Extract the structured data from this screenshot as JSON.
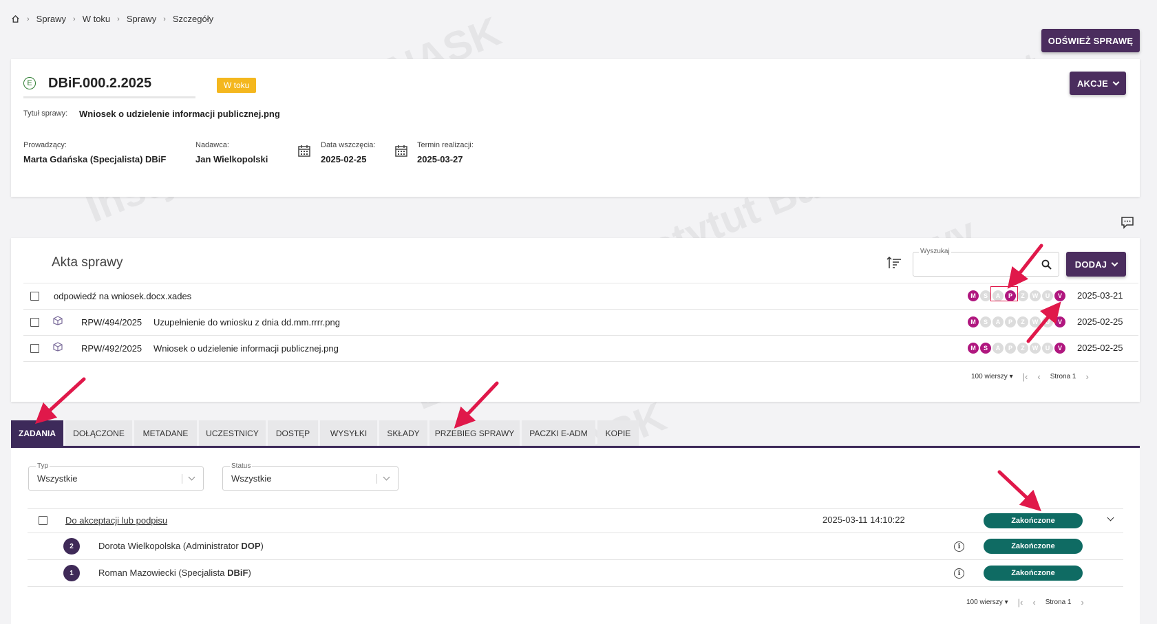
{
  "breadcrumb": {
    "home_icon": "home-icon",
    "items": [
      "Sprawy",
      "W toku",
      "Sprawy",
      "Szczegóły"
    ]
  },
  "header_actions": {
    "refresh_label": "ODŚWIEŻ SPRAWĘ",
    "actions_label": "AKCJE"
  },
  "case": {
    "number": "DBiF.000.2.2025",
    "status": "W toku",
    "title_label": "Tytuł sprawy:",
    "title_value": "Wniosek o udzielenie informacji publicznej.png",
    "fields": {
      "owner_label": "Prowadzący:",
      "owner_value": "Marta Gdańska (Specjalista) DBiF",
      "sender_label": "Nadawca:",
      "sender_value": "Jan Wielkopolski",
      "start_label": "Data wszczęcia:",
      "start_value": "2025-02-25",
      "due_label": "Termin realizacji:",
      "due_value": "2025-03-27"
    }
  },
  "akta": {
    "title": "Akta sprawy",
    "search_label": "Wyszukaj",
    "add_label": "DODAJ",
    "rows": [
      {
        "ref": "",
        "name": "odpowiedź na wniosek.docx.xades",
        "date": "2025-03-21",
        "dots": [
          1,
          0,
          0,
          1,
          0,
          0,
          0,
          1
        ]
      },
      {
        "ref": "RPW/494/2025",
        "name": "Uzupełnienie do wniosku z dnia dd.mm.rrrr.png",
        "date": "2025-02-25",
        "dots": [
          1,
          0,
          0,
          0,
          0,
          0,
          0,
          1
        ]
      },
      {
        "ref": "RPW/492/2025",
        "name": "Wniosek o udzielenie informacji publicznej.png",
        "date": "2025-02-25",
        "dots": [
          1,
          1,
          0,
          0,
          0,
          0,
          0,
          1
        ]
      }
    ],
    "dot_letters": [
      "M",
      "S",
      "A",
      "P",
      "Z",
      "W",
      "U",
      "V"
    ],
    "pager": {
      "rows": "100 wierszy",
      "page": "Strona 1"
    }
  },
  "tabs": [
    "ZADANIA",
    "DOŁĄCZONE",
    "METADANE",
    "UCZESTNICY",
    "DOSTĘP",
    "WYSYŁKI",
    "SKŁADY",
    "PRZEBIEG SPRAWY",
    "PACZKI E-ADM",
    "KOPIE"
  ],
  "filters": {
    "type_label": "Typ",
    "type_value": "Wszystkie",
    "status_label": "Status",
    "status_value": "Wszystkie"
  },
  "tasks": {
    "main": {
      "name": "Do akceptacji lub podpisu",
      "datetime": "2025-03-11 14:10:22",
      "status": "Zakończone"
    },
    "subs": [
      {
        "num": "2",
        "person": "Dorota Wielkopolska (Administrator ",
        "dept": "DOP",
        "close": ")",
        "status": "Zakończone"
      },
      {
        "num": "1",
        "person": "Roman Mazowiecki (Specjalista ",
        "dept": "DBiF",
        "close": ")",
        "status": "Zakończone"
      }
    ],
    "pager": {
      "rows": "100 wierszy",
      "page": "Strona 1"
    }
  },
  "colors": {
    "primary": "#4b2d5e",
    "status_yellow": "#f4b71e",
    "done_green": "#0f6b63",
    "signature_on": "#b0177f",
    "annotation_red": "#e0184a"
  }
}
